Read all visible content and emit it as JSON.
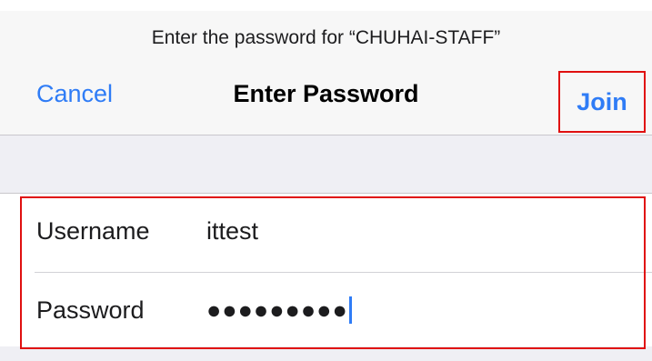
{
  "prompt": "Enter the password for “CHUHAI-STAFF”",
  "nav": {
    "cancel_label": "Cancel",
    "title": "Enter Password",
    "join_label": "Join"
  },
  "form": {
    "username": {
      "label": "Username",
      "value": "ittest"
    },
    "password": {
      "label": "Password",
      "value": "●●●●●●●●●"
    }
  },
  "colors": {
    "accent": "#2f7cf6",
    "highlight_box": "#e01010",
    "background": "#efeff4"
  }
}
